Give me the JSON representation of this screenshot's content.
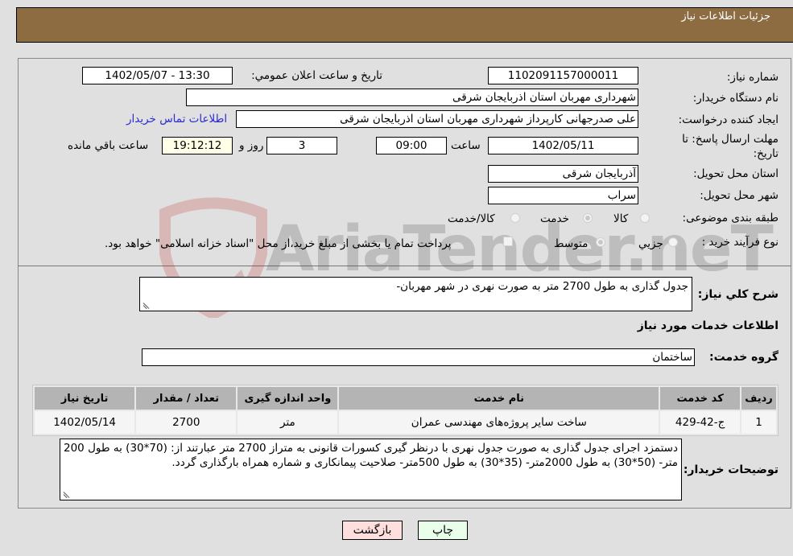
{
  "header": {
    "title": "جزئيات اطلاعات نياز"
  },
  "form": {
    "need_number_label": "شماره نیاز:",
    "need_number": "1102091157000011",
    "announce_label": "تاریخ و ساعت اعلان عمومي:",
    "announce_value": "1402/05/07 - 13:30",
    "buyer_org_label": "نام دستگاه خریدار:",
    "buyer_org": "شهرداری مهربان استان اذربایجان شرقی",
    "requester_label": "ایجاد کننده درخواست:",
    "requester": "علی  صدرجهانی  کارپرداز شهرداری مهربان استان اذربایجان شرقی",
    "contact_link": "اطلاعات تماس خریدار",
    "deadline_label_1": "مهلت ارسال پاسخ: تا",
    "deadline_label_2": "تاریخ:",
    "deadline_date": "1402/05/11",
    "hour_label": "ساعت",
    "deadline_time": "09:00",
    "days_value": "3",
    "days_label": "روز و",
    "remaining_time": "19:12:12",
    "remaining_label": "ساعت باقي مانده",
    "province_label": "استان محل تحویل:",
    "province": "آذربایجان شرقی",
    "city_label": "شهر محل تحویل:",
    "city": "سراب",
    "category_label": "طبقه بندی موضوعی:",
    "category_options": [
      "کالا",
      "خدمت",
      "کالا/خدمت"
    ],
    "category_selected": "خدمت",
    "process_label": "نوع فرآیند خرید :",
    "process_options": [
      "جزيي",
      "متوسط"
    ],
    "process_selected": "متوسط",
    "payment_note": "پرداخت تمام یا بخشی از مبلغ خرید،از محل \"اسناد خزانه اسلامی\" خواهد بود."
  },
  "summary": {
    "label": "شرح كلي نياز:",
    "value": "جدول گذاری به طول 2700 متر به صورت نهری در شهر مهربان-"
  },
  "services": {
    "section_title": "اطلاعات خدمات مورد نياز",
    "group_label": "گروه خدمت:",
    "group_value": "ساختمان",
    "columns": [
      "ردیف",
      "کد خدمت",
      "نام خدمت",
      "واحد اندازه گیری",
      "تعداد / مقدار",
      "تاریخ نیاز"
    ],
    "rows": [
      [
        "1",
        "ج-42-429",
        "ساخت سایر پروژه‌های مهندسی عمران",
        "متر",
        "2700",
        "1402/05/14"
      ]
    ]
  },
  "buyer_notes": {
    "label": "توضیحات خریدار:",
    "value": "دستمزد اجرای جدول گذاری به صورت جدول نهری با درنظر گیری کسورات قانونی به متراز 2700 متر عبارتند از: (70*30) به طول 200 متر- (50*30) به طول 2000متر- (35*30) به طول 500متر- صلاحیت پیمانکاری و شماره همراه بارگذاری گردد."
  },
  "buttons": {
    "print": "چاپ",
    "back": "بازگشت"
  },
  "watermark": {
    "text": "AriaTender.neT"
  },
  "colors": {
    "header_bg": "#8e6c42",
    "back_bg": "#ffdede",
    "print_bg": "#eaffea",
    "link": "#2a2ad0"
  }
}
